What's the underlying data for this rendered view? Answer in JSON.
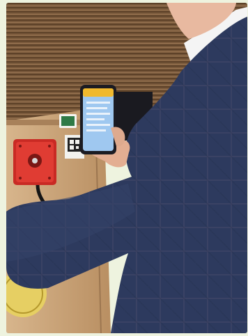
{
  "image": {
    "alt": "",
    "colors": {
      "frame": "#eef3df",
      "wood_panel": "#7a5a3c",
      "cabinet": "#c8a27a",
      "jacket": "#2d3a5e",
      "shirt": "#f4f4f4",
      "skin": "#e8b9a0",
      "phone_body": "#1b1b22",
      "phone_screen": "#9fc8f0",
      "phone_header": "#f0b92e",
      "red_box": "#d6332c",
      "sticker": "#e8d36a"
    }
  }
}
